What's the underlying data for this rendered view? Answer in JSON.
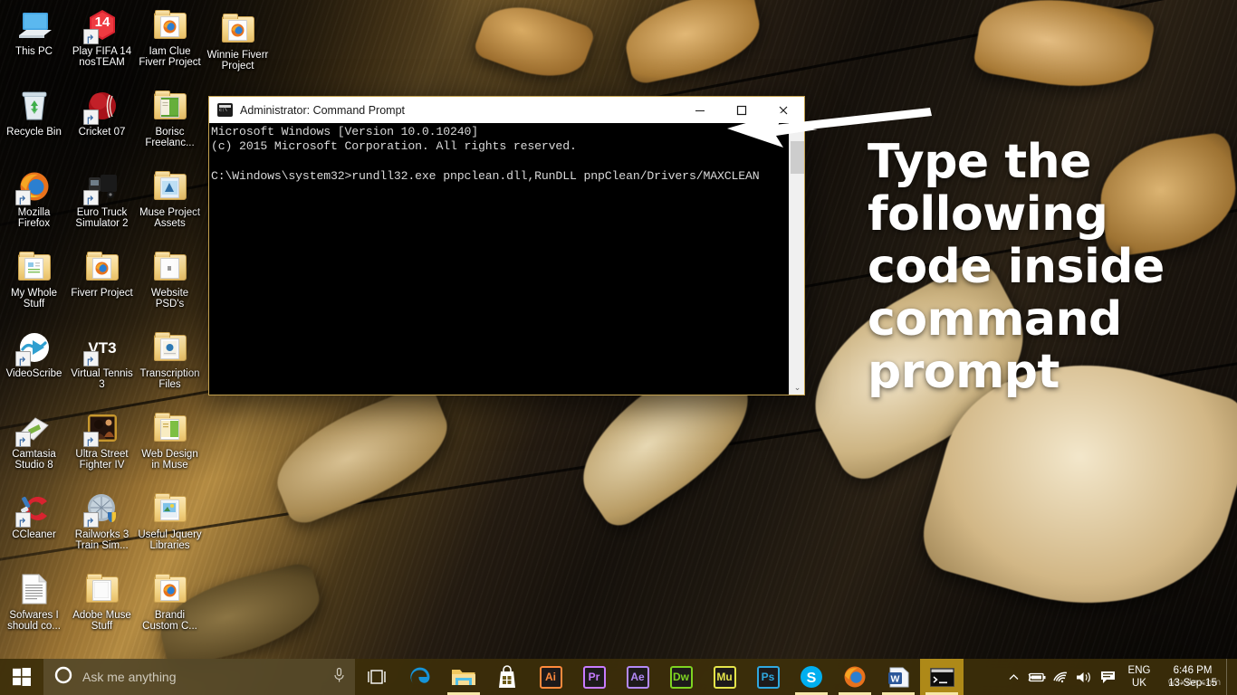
{
  "window_title": "Administrator: Command Prompt",
  "desktop": {
    "icons": [
      {
        "label": "This PC",
        "icon": "this-pc-icon",
        "type": "computer"
      },
      {
        "label": "Play FIFA 14 nosTEAM",
        "icon": "fifa-14-icon",
        "type": "shortcut-red-hex"
      },
      {
        "label": "Iam Clue Fiverr Project",
        "icon": "folder-firefox-icon",
        "type": "folder-firefox"
      },
      {
        "label": "Winnie Fiverr Project",
        "icon": "folder-firefox-icon",
        "type": "folder-firefox"
      },
      {
        "label": "Recycle Bin",
        "icon": "recycle-bin-icon",
        "type": "recycle"
      },
      {
        "label": "Cricket 07",
        "icon": "cricket-07-icon",
        "type": "shortcut-ball"
      },
      {
        "label": "Borisc Freelanc...",
        "icon": "folder-green-doc-icon",
        "type": "folder-green"
      },
      {
        "label": "Mozilla Firefox",
        "icon": "firefox-icon",
        "type": "shortcut-firefox"
      },
      {
        "label": "Euro Truck Simulator 2",
        "icon": "euro-truck-icon",
        "type": "shortcut-truck"
      },
      {
        "label": "Muse Project Assets",
        "icon": "folder-muse-icon",
        "type": "folder-muse"
      },
      {
        "label": "My Whole Stuff",
        "icon": "folder-docs-icon",
        "type": "folder-docs"
      },
      {
        "label": "Fiverr Project",
        "icon": "folder-firefox-icon",
        "type": "folder-firefox"
      },
      {
        "label": "Website PSD's",
        "icon": "folder-plain-icon",
        "type": "folder-plain"
      },
      {
        "label": "VideoScribe",
        "icon": "videoscribe-icon",
        "type": "shortcut-videoscribe"
      },
      {
        "label": "Virtual Tennis 3",
        "icon": "vt3-icon",
        "type": "shortcut-vt3"
      },
      {
        "label": "Transcription Files",
        "icon": "folder-transcription-icon",
        "type": "folder-transcription"
      },
      {
        "label": "Camtasia Studio 8",
        "icon": "camtasia-icon",
        "type": "shortcut-camtasia"
      },
      {
        "label": "Ultra Street Fighter IV",
        "icon": "street-fighter-icon",
        "type": "shortcut-sf"
      },
      {
        "label": "Web Design in Muse",
        "icon": "folder-webdesign-icon",
        "type": "folder-webdesign"
      },
      {
        "label": "CCleaner",
        "icon": "ccleaner-icon",
        "type": "shortcut-ccleaner"
      },
      {
        "label": "Railworks 3 Train Sim...",
        "icon": "railworks-icon",
        "type": "shortcut-railworks"
      },
      {
        "label": "Useful Jquery Libraries",
        "icon": "folder-jquery-icon",
        "type": "folder-jquery"
      },
      {
        "label": "Sofwares I should co...",
        "icon": "text-document-icon",
        "type": "textfile"
      },
      {
        "label": "Adobe Muse Stuff",
        "icon": "folder-paper-icon",
        "type": "folder-paper"
      },
      {
        "label": "Brandi Custom C...",
        "icon": "folder-firefox-icon",
        "type": "folder-firefox"
      }
    ]
  },
  "cmd": {
    "title": "Administrator: Command Prompt",
    "minimize_label": "Minimize",
    "maximize_label": "Maximize",
    "close_label": "Close",
    "output": "Microsoft Windows [Version 10.0.10240]\n(c) 2015 Microsoft Corporation. All rights reserved.\n\nC:\\Windows\\system32>rundll32.exe pnpclean.dll,RunDLL pnpClean/Drivers/MAXCLEAN"
  },
  "annotation": {
    "text": "Type the following code inside command prompt",
    "arrow": "left-pointing-arrow"
  },
  "taskbar": {
    "start_label": "Start",
    "search_placeholder": "Ask me anything",
    "cortana_icon": "cortana-circle-icon",
    "microphone_icon": "microphone-icon",
    "taskview_label": "Task View",
    "apps": [
      {
        "name": "Microsoft Edge",
        "icon": "edge-icon",
        "running": false,
        "active": false,
        "text": "e",
        "color": "#0f7fc4"
      },
      {
        "name": "File Explorer",
        "icon": "file-explorer-icon",
        "running": true,
        "active": false,
        "text": "",
        "color": "#f0c060"
      },
      {
        "name": "Microsoft Store",
        "icon": "store-icon",
        "running": false,
        "active": false,
        "text": "",
        "color": "#ffffff"
      },
      {
        "name": "Adobe Illustrator",
        "icon": "illustrator-icon",
        "running": false,
        "active": false,
        "text": "Ai",
        "color": "#ff8a3c"
      },
      {
        "name": "Adobe Premiere Pro",
        "icon": "premiere-icon",
        "running": false,
        "active": false,
        "text": "Pr",
        "color": "#c87bff"
      },
      {
        "name": "Adobe After Effects",
        "icon": "after-effects-icon",
        "running": false,
        "active": false,
        "text": "Ae",
        "color": "#b389f7"
      },
      {
        "name": "Adobe Dreamweaver",
        "icon": "dreamweaver-icon",
        "running": false,
        "active": false,
        "text": "Dw",
        "color": "#7ed321"
      },
      {
        "name": "Adobe Muse",
        "icon": "muse-icon",
        "running": false,
        "active": false,
        "text": "Mu",
        "color": "#e4e44a"
      },
      {
        "name": "Adobe Photoshop",
        "icon": "photoshop-icon",
        "running": false,
        "active": false,
        "text": "Ps",
        "color": "#2fa8e0"
      },
      {
        "name": "Skype",
        "icon": "skype-icon",
        "running": true,
        "active": false,
        "text": "S",
        "color": "#00aff0"
      },
      {
        "name": "Mozilla Firefox",
        "icon": "firefox-icon",
        "running": true,
        "active": false,
        "text": "",
        "color": "#e8721c"
      },
      {
        "name": "Microsoft Word",
        "icon": "word-icon",
        "running": true,
        "active": false,
        "text": "W",
        "color": "#2b579a"
      },
      {
        "name": "Command Prompt",
        "icon": "command-prompt-icon",
        "running": true,
        "active": true,
        "text": "",
        "color": "#111111"
      }
    ],
    "tray": [
      {
        "name": "show-hidden-icons",
        "icon": "chevron-up-icon"
      },
      {
        "name": "battery",
        "icon": "battery-icon"
      },
      {
        "name": "network",
        "icon": "wifi-icon"
      },
      {
        "name": "volume",
        "icon": "speaker-icon"
      },
      {
        "name": "action-center",
        "icon": "action-center-icon"
      }
    ],
    "language_line1": "ENG",
    "language_line2": "UK",
    "clock_time": "6:46 PM",
    "clock_date": "13-Sep-15",
    "watermark": "wsxdn.com"
  },
  "colors": {
    "taskbar": "#3c2e0a",
    "accent": "#d6aa1e",
    "window_border": "#c4a250",
    "titlebar": "#ffffff",
    "console_bg": "#000000",
    "console_fg": "#d8d8d8",
    "annotation_text": "#ffffff"
  }
}
